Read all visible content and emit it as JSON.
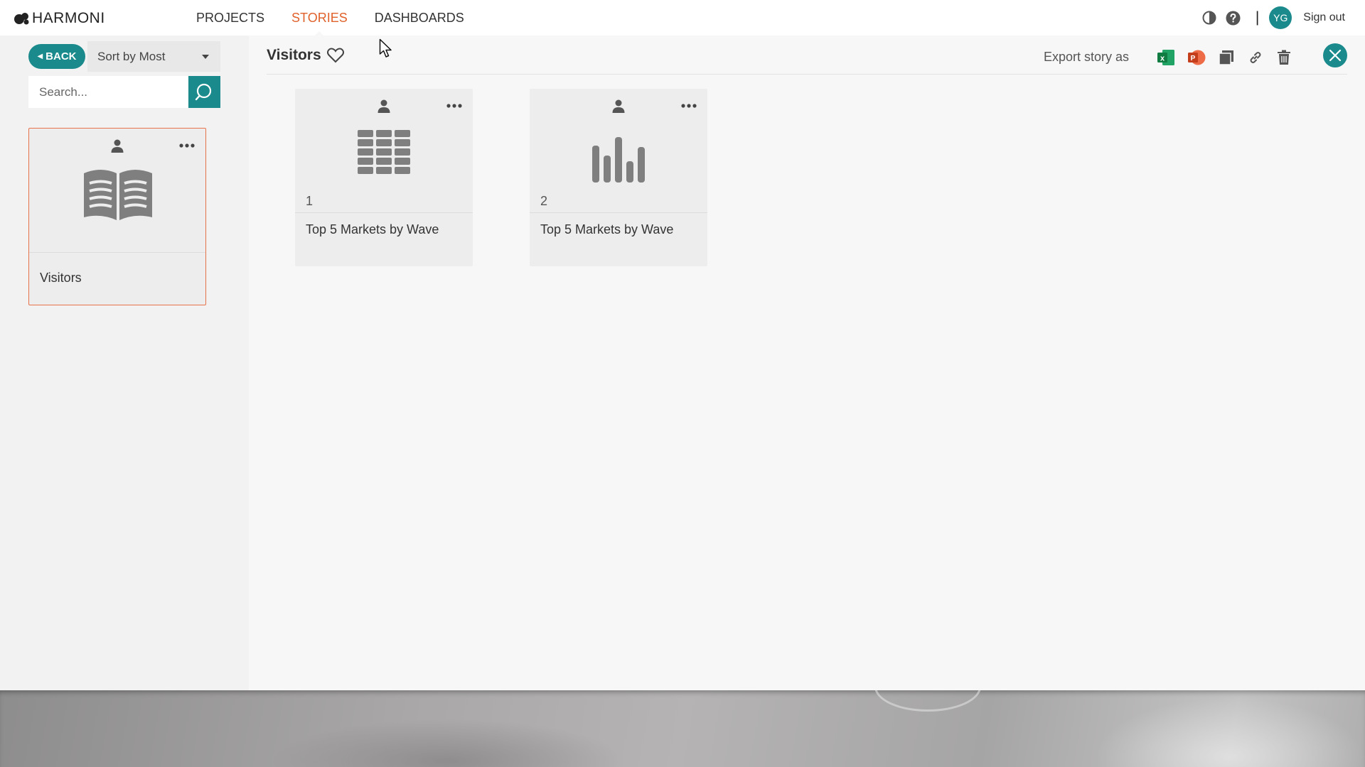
{
  "brand": {
    "name": "HARMONI"
  },
  "nav": {
    "items": [
      {
        "label": "PROJECTS",
        "active": false
      },
      {
        "label": "STORIES",
        "active": true
      },
      {
        "label": "DASHBOARDS",
        "active": false
      }
    ]
  },
  "header": {
    "separator": "|",
    "avatar_initials": "YG",
    "signout_label": "Sign out",
    "icons": [
      "contrast-icon",
      "help-icon"
    ]
  },
  "sidebar": {
    "back_label": "BACK",
    "sort": {
      "selected": "Sort by Most"
    },
    "search": {
      "placeholder": "Search...",
      "value": ""
    },
    "stories": [
      {
        "title": "Visitors",
        "icon": "book-icon",
        "selected": true
      }
    ]
  },
  "main": {
    "story_title": "Visitors",
    "export_label": "Export story as",
    "actions": [
      "excel-icon",
      "powerpoint-icon",
      "copy-icon",
      "link-icon",
      "trash-icon",
      "close-icon"
    ],
    "tiles": [
      {
        "number": "1",
        "title": "Top 5 Markets by Wave",
        "icon": "table-grid-icon"
      },
      {
        "number": "2",
        "title": "Top 5 Markets by Wave",
        "icon": "bar-chart-icon"
      }
    ]
  },
  "colors": {
    "accent": "#1a8a8c",
    "active_nav": "#e0612b",
    "selected_border": "#e8734a",
    "excel": "#1d7a44",
    "powerpoint": "#d24726"
  }
}
